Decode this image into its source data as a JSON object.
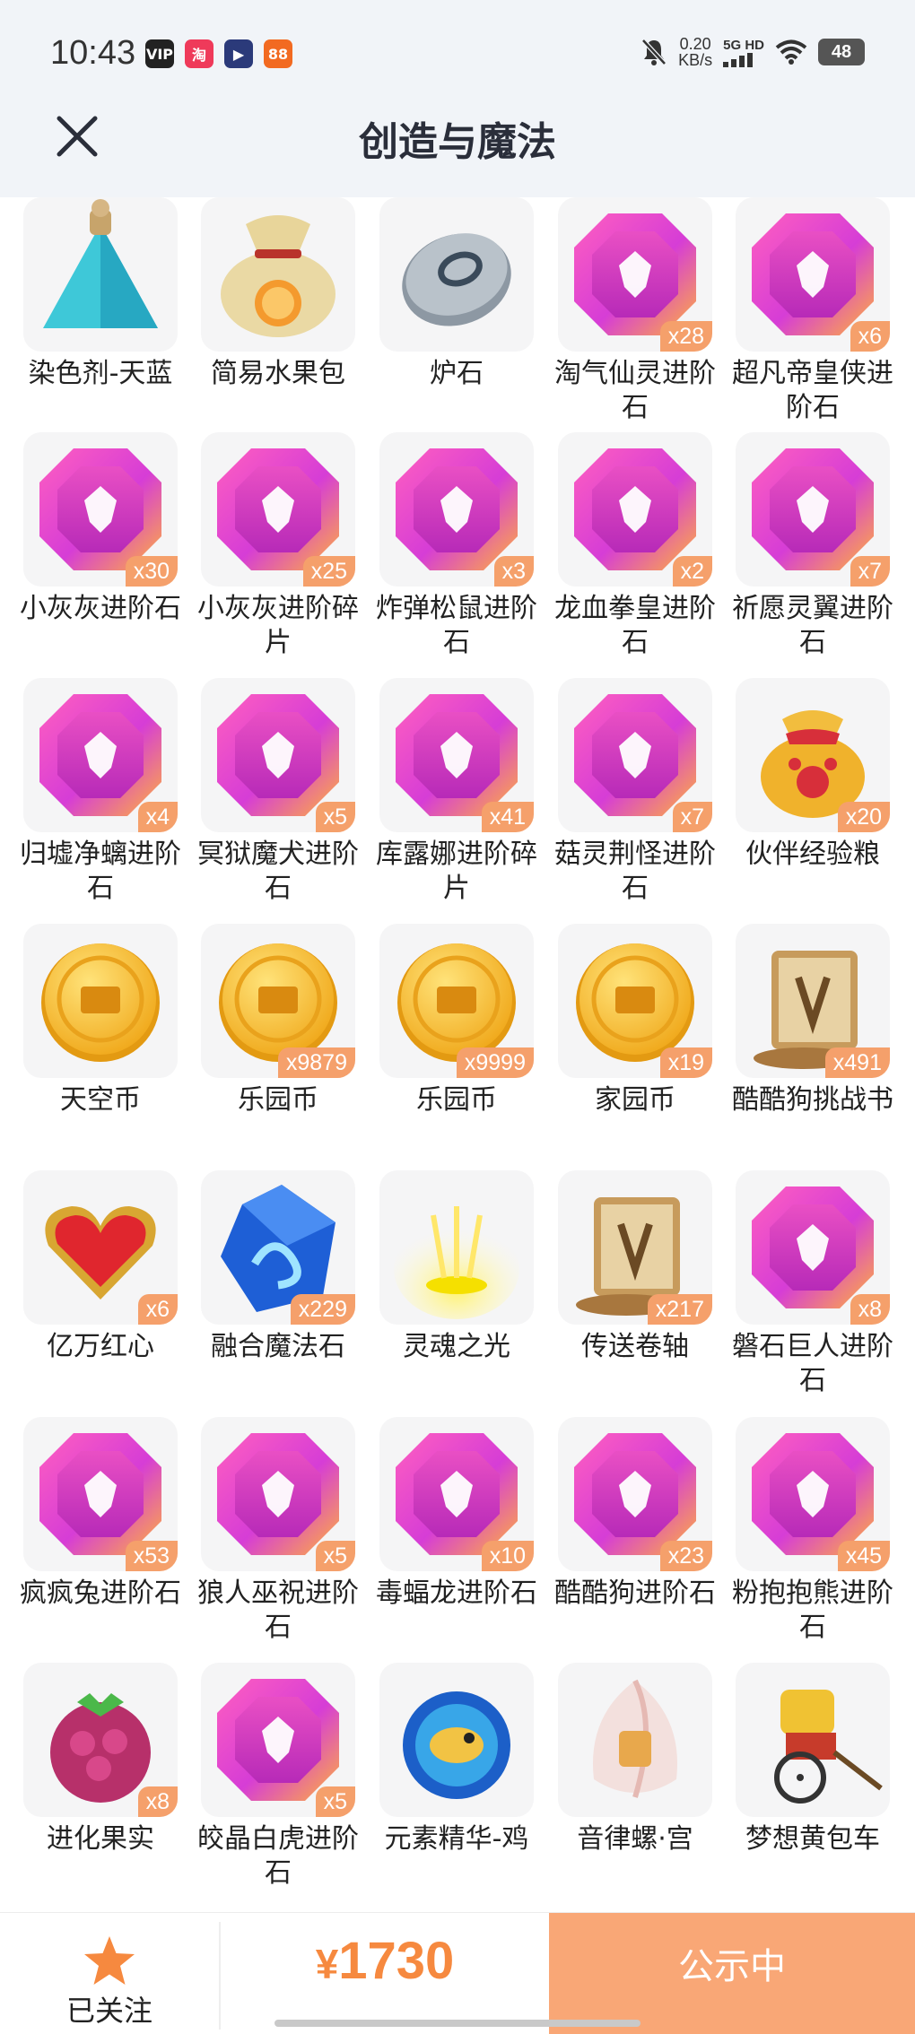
{
  "status_bar": {
    "time": "10:43",
    "apps": [
      {
        "icon": "vip-app-icon",
        "text": "VIP",
        "color": "#222222"
      },
      {
        "icon": "taobao-app-icon",
        "text": "淘",
        "color": "#ef3a5a"
      },
      {
        "icon": "video-app-icon",
        "text": "▶",
        "color": "#2b3a7a"
      },
      {
        "icon": "shop-app-icon",
        "text": "88",
        "color": "#f26a21"
      }
    ],
    "net_speed": "0.20",
    "net_unit": "KB/s",
    "network": "5G HD",
    "battery": "48"
  },
  "header": {
    "title": "创造与魔法",
    "close_icon": "close-icon"
  },
  "items": [
    {
      "name": "染色剂-天蓝",
      "qty": "",
      "icon": "dye-bottle-icon"
    },
    {
      "name": "简易水果包",
      "qty": "",
      "icon": "fruit-bag-icon"
    },
    {
      "name": "炉石",
      "qty": "",
      "icon": "hearthstone-icon"
    },
    {
      "name": "淘气仙灵进阶石",
      "qty": "x28",
      "icon": "gem-icon"
    },
    {
      "name": "超凡帝皇侠进阶石",
      "qty": "x6",
      "icon": "gem-icon"
    },
    {
      "name": "小灰灰进阶石",
      "qty": "x30",
      "icon": "gem-icon"
    },
    {
      "name": "小灰灰进阶碎片",
      "qty": "x25",
      "icon": "gem-icon"
    },
    {
      "name": "炸弹松鼠进阶石",
      "qty": "x3",
      "icon": "gem-icon"
    },
    {
      "name": "龙血拳皇进阶石",
      "qty": "x2",
      "icon": "gem-icon"
    },
    {
      "name": "祈愿灵翼进阶石",
      "qty": "x7",
      "icon": "gem-icon"
    },
    {
      "name": "归墟净螭进阶石",
      "qty": "x4",
      "icon": "gem-icon"
    },
    {
      "name": "冥狱魔犬进阶石",
      "qty": "x5",
      "icon": "gem-icon"
    },
    {
      "name": "库露娜进阶碎片",
      "qty": "x41",
      "icon": "gem-icon"
    },
    {
      "name": "菇灵荆怪进阶石",
      "qty": "x7",
      "icon": "gem-icon"
    },
    {
      "name": "伙伴经验粮",
      "qty": "x20",
      "icon": "pet-food-bag-icon"
    },
    {
      "name": "天空币",
      "qty": "",
      "icon": "coin-icon"
    },
    {
      "name": "乐园币",
      "qty": "x9879",
      "icon": "coin-icon"
    },
    {
      "name": "乐园币",
      "qty": "x9999",
      "icon": "coin-icon"
    },
    {
      "name": "家园币",
      "qty": "x19",
      "icon": "coin-icon"
    },
    {
      "name": "酷酷狗挑战书",
      "qty": "x491",
      "icon": "scroll-icon"
    },
    {
      "name": "亿万红心",
      "qty": "x6",
      "icon": "heart-gem-icon"
    },
    {
      "name": "融合魔法石",
      "qty": "x229",
      "icon": "magic-stone-icon"
    },
    {
      "name": "灵魂之光",
      "qty": "",
      "icon": "soul-light-icon"
    },
    {
      "name": "传送卷轴",
      "qty": "x217",
      "icon": "scroll-icon"
    },
    {
      "name": "磐石巨人进阶石",
      "qty": "x8",
      "icon": "gem-icon"
    },
    {
      "name": "疯疯兔进阶石",
      "qty": "x53",
      "icon": "gem-icon"
    },
    {
      "name": "狼人巫祝进阶石",
      "qty": "x5",
      "icon": "gem-icon"
    },
    {
      "name": "毒蝠龙进阶石",
      "qty": "x10",
      "icon": "gem-icon"
    },
    {
      "name": "酷酷狗进阶石",
      "qty": "x23",
      "icon": "gem-icon"
    },
    {
      "name": "粉抱抱熊进阶石",
      "qty": "x45",
      "icon": "gem-icon"
    },
    {
      "name": "进化果实",
      "qty": "x8",
      "icon": "berry-icon"
    },
    {
      "name": "皎晶白虎进阶石",
      "qty": "x5",
      "icon": "gem-icon"
    },
    {
      "name": "元素精华-鸡",
      "qty": "",
      "icon": "element-orb-icon"
    },
    {
      "name": "音律螺·宫",
      "qty": "",
      "icon": "conch-icon"
    },
    {
      "name": "梦想黄包车",
      "qty": "",
      "icon": "rickshaw-icon"
    }
  ],
  "bottom_bar": {
    "follow_label": "已关注",
    "follow_icon": "star-icon",
    "price_symbol": "¥",
    "price": "1730",
    "status_button": "公示中"
  },
  "colors": {
    "accent": "#f6893f",
    "badge": "#f5a06b",
    "button": "#f9a776",
    "header_bg": "#f1f4f8"
  }
}
